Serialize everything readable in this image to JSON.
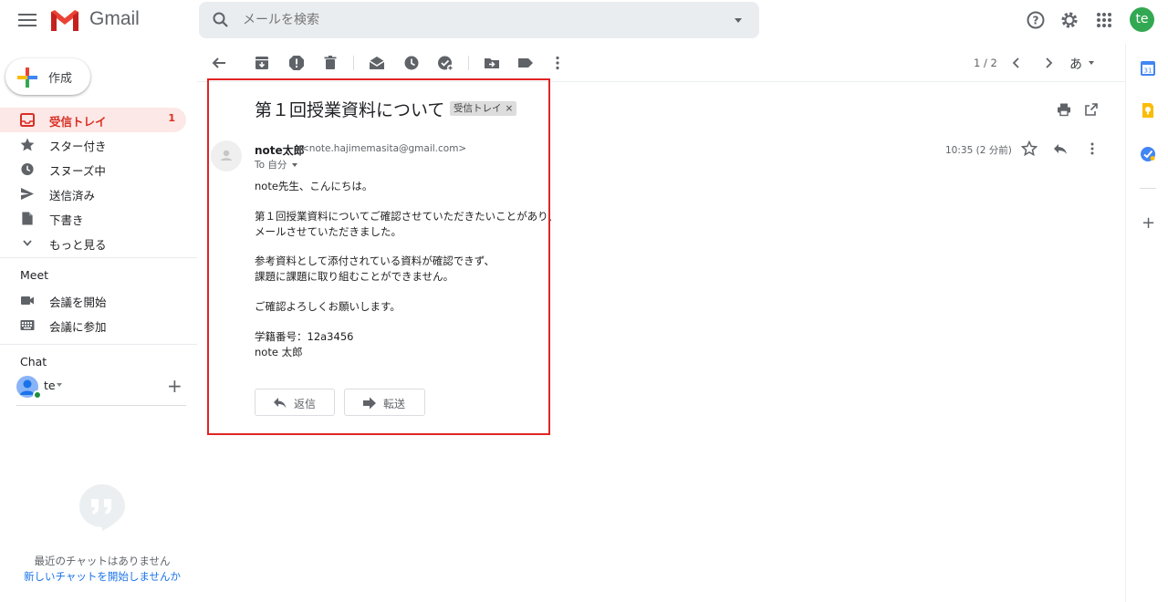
{
  "app": {
    "name": "Gmail",
    "avatar_letter": "te"
  },
  "search": {
    "placeholder": "メールを検索"
  },
  "sidebar": {
    "compose_label": "作成",
    "items": [
      {
        "label": "受信トレイ",
        "count": "1",
        "icon": "inbox-icon"
      },
      {
        "label": "スター付き",
        "icon": "star-icon"
      },
      {
        "label": "スヌーズ中",
        "icon": "clock-icon"
      },
      {
        "label": "送信済み",
        "icon": "send-icon"
      },
      {
        "label": "下書き",
        "icon": "draft-icon"
      },
      {
        "label": "もっと見る",
        "icon": "chevron-down-icon"
      }
    ],
    "meet_title": "Meet",
    "meet_items": [
      {
        "label": "会議を開始",
        "icon": "video-icon"
      },
      {
        "label": "会議に参加",
        "icon": "keyboard-icon"
      }
    ],
    "chat_title": "Chat",
    "chat_user": "te",
    "no_chat": "最近のチャットはありません",
    "start_chat": "新しいチャットを開始しませんか"
  },
  "toolbar": {
    "pager": "1 / 2",
    "lang": "あ"
  },
  "email": {
    "subject": "第１回授業資料について",
    "label_chip": "受信トレイ",
    "sender_name": "note太郎",
    "sender_email": "<note.hajimemasita@gmail.com>",
    "to": "To 自分",
    "time": "10:35 (2 分前)",
    "body": [
      "note先生、こんにちは。",
      "第１回授業資料についてご確認させていただきたいことがあり、",
      "メールさせていただきました。",
      "参考資料として添付されている資料が確認できず、",
      "課題に課題に取り組むことができません。",
      "ご確認よろしくお願いします。",
      "学籍番号：12a3456",
      "note 太郎"
    ],
    "reply_label": "返信",
    "forward_label": "転送"
  },
  "colors": {
    "accent_red": "#d93025",
    "highlight": "#e02424",
    "link": "#1a73e8"
  }
}
